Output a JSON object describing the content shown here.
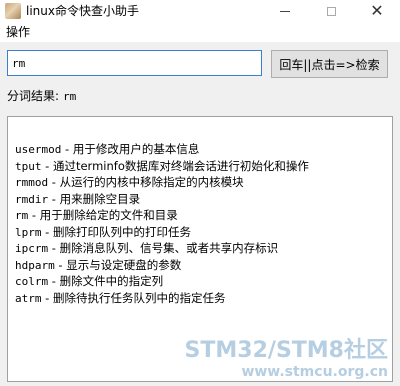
{
  "window": {
    "title": "linux命令快查小助手",
    "icon": "app-photo-icon"
  },
  "menu": {
    "items": [
      {
        "label": "操作"
      }
    ]
  },
  "search": {
    "value": "rm",
    "button_label": "回车||点击=>检索"
  },
  "segmentation": {
    "label": "分词结果:",
    "value": "rm"
  },
  "results": [
    {
      "cmd": "usermod",
      "desc": "用于修改用户的基本信息"
    },
    {
      "cmd": "tput",
      "desc": "通过terminfo数据库对终端会话进行初始化和操作"
    },
    {
      "cmd": "rmmod",
      "desc": "从运行的内核中移除指定的内核模块"
    },
    {
      "cmd": "rmdir",
      "desc": "用来删除空目录"
    },
    {
      "cmd": "rm",
      "desc": "用于删除给定的文件和目录"
    },
    {
      "cmd": "lprm",
      "desc": "删除打印队列中的打印任务"
    },
    {
      "cmd": "ipcrm",
      "desc": "删除消息队列、信号集、或者共享内存标识"
    },
    {
      "cmd": "hdparm",
      "desc": "显示与设定硬盘的参数"
    },
    {
      "cmd": "colrm",
      "desc": "删除文件中的指定列"
    },
    {
      "cmd": "atrm",
      "desc": "删除待执行任务队列中的指定任务"
    }
  ],
  "separator": " - ",
  "watermark": {
    "line1": "STM32/STM8社区",
    "line2": "www.stmcu.org.cn"
  }
}
